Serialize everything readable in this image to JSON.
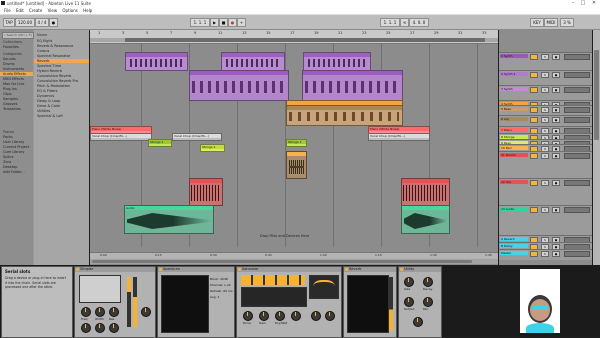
{
  "window": {
    "title": "untitled* [untitled] - Ableton Live 11 Suite",
    "controls": [
      "–",
      "□",
      "✕"
    ]
  },
  "menu": [
    "File",
    "Edit",
    "Create",
    "View",
    "Options",
    "Help"
  ],
  "transport": {
    "tempo": "120.00",
    "time_sig": "4 / 4",
    "position": "1. 1. 1",
    "loop_start": "1. 1. 1",
    "loop_len": "4. 0. 0",
    "key": "KEY",
    "midi": "MIDI",
    "cpu": "3 %"
  },
  "browser": {
    "search_placeholder": "Search (Ctrl + F)",
    "collections_head": "Collections",
    "collections": [
      "Favorites"
    ],
    "categories_head": "Categories",
    "categories": [
      "Sounds",
      "Drums",
      "Instruments",
      "Audio Effects",
      "MIDI Effects",
      "Max for Live",
      "Plug-ins",
      "Clips",
      "Samples",
      "Grooves",
      "Templates"
    ],
    "places_head": "Places",
    "places": [
      "Packs",
      "User Library",
      "Current Project",
      "Core Library",
      "Splice",
      "Zora",
      "Desktop",
      "Add Folder..."
    ],
    "name_head": "Name",
    "items": [
      "EQ Eight",
      "Reverb & Resonance",
      "Corpus",
      "Spectral Resonator",
      "Reverb",
      "Spectral Time",
      "Hybrid Reverb",
      "Convolution Reverb",
      "Convolution Reverb Pro",
      "Pitch & Modulation",
      "EQ & Filters",
      "Dynamics",
      "Delay & Loop",
      "Drive & Color",
      "Utilities",
      "Spectral & Lofi"
    ],
    "selected_category": "Audio Effects",
    "selected_item": "Reverb",
    "info_title": "Serial slots",
    "info_text": "Drag a device or plug-in here to insert it into the chain. Serial slots are processed one after the other."
  },
  "arrangement": {
    "bar_numbers": [
      "1",
      "3",
      "5",
      "7",
      "9",
      "11",
      "13",
      "15",
      "17",
      "19",
      "21",
      "23",
      "25",
      "27",
      "29",
      "31",
      "33"
    ],
    "time_labels": [
      "0:00",
      "0:15",
      "0:30",
      "0:45",
      "1:00",
      "1:15",
      "1:30",
      "1:45"
    ],
    "drop_hint": "Drop Files and Devices Here",
    "clip_labels": {
      "piano1": "Piano (White Noise)",
      "piano2": "Piano (White Noise)",
      "vocal1": "Vocal Chop (Cmaj Eb...)",
      "vocal2": "Vocal Chop (Cmaj Eb...)",
      "vocal3": "Vocal Chop (Cmaj Eb...)",
      "strings1": "Strings 1",
      "strings2": "Strings 1",
      "strings3": "Strings 1",
      "audio": "Audio"
    }
  },
  "tracks": [
    {
      "name": "1 Synth",
      "color": "#9b59b6"
    },
    {
      "name": "2 Synth 2",
      "color": "#b07cc6"
    },
    {
      "name": "3 Synth",
      "color": "#c589dc"
    },
    {
      "name": "4 Synth",
      "color": "#f0a44a"
    },
    {
      "name": "5 Bass",
      "color": "#c99c6e"
    },
    {
      "name": "6 Arp",
      "color": "#a58963"
    },
    {
      "name": "7 Piano",
      "color": "#ff6b6b"
    },
    {
      "name": "8 Strings",
      "color": "#c4e852"
    },
    {
      "name": "9 Keys",
      "color": "#d9ec6c"
    },
    {
      "name": "10 Perc",
      "color": "#f7b34b"
    },
    {
      "name": "11 Drums",
      "color": "#e25353"
    },
    {
      "name": "12 Vox",
      "color": "#e25353"
    },
    {
      "name": "13 Audio",
      "color": "#34d39c"
    },
    {
      "name": "A Reverb",
      "color": "#49d3e0"
    },
    {
      "name": "B Delay",
      "color": "#49d3e0"
    },
    {
      "name": "Master",
      "color": "#49d3e0"
    }
  ],
  "devices": {
    "d1": "Simpler",
    "d2": "Spectrum",
    "d3": "Saturator",
    "d4": "Reverb",
    "d5": "Utility",
    "spectrum_info": [
      "Block: 2048",
      "Channel: L+R",
      "Refresh: 60 ms",
      "Avg: 1"
    ],
    "knob_labels": [
      "Freq",
      "Width",
      "Res",
      "Drive",
      "Gain",
      "Dry/Wet",
      "Size",
      "Decay",
      "Output",
      "Pan"
    ]
  },
  "colors": {
    "accent": "#f7b232",
    "purple": "#a262c4",
    "orange": "#f0a44a",
    "red": "#e05656",
    "green": "#48d89b",
    "yellow": "#d7ec5a"
  }
}
